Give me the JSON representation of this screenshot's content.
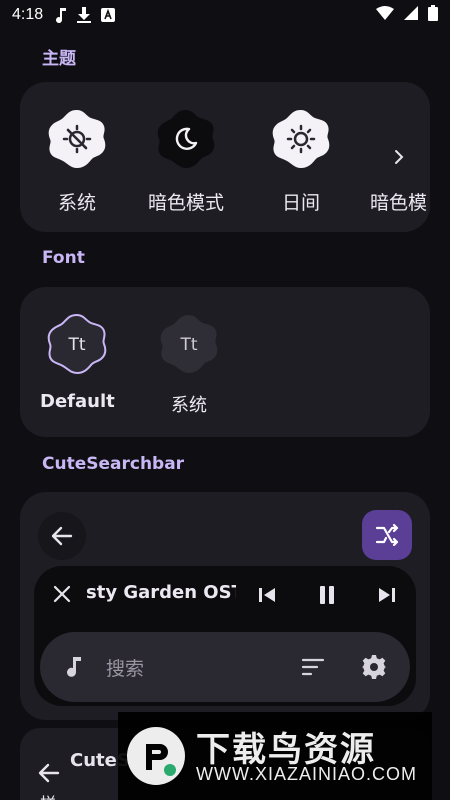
{
  "status_bar": {
    "time": "4:18",
    "icons": [
      "music-note-icon",
      "download-icon",
      "a-badge-icon",
      "wifi-icon",
      "cellular-icon",
      "battery-icon"
    ]
  },
  "sections": {
    "theme_title": "主题",
    "font_title": "Font",
    "searchbar_title": "CuteSearchbar"
  },
  "theme": {
    "items": [
      {
        "label": "系统",
        "icon": "system-theme-icon",
        "selected": false
      },
      {
        "label": "暗色模式",
        "icon": "moon-icon",
        "selected": true
      },
      {
        "label": "日间",
        "icon": "sun-icon",
        "selected": false
      },
      {
        "label": "暗色模",
        "icon": "partial-item",
        "selected": false
      }
    ],
    "next_icon": "chevron-right-icon"
  },
  "font": {
    "items": [
      {
        "label": "Default",
        "glyph": "Tt",
        "selected": true
      },
      {
        "label": "系统",
        "glyph": "Tt",
        "selected": false
      }
    ]
  },
  "searchbar_preview": {
    "back_icon": "arrow-left-icon",
    "shuffle_icon": "shuffle-icon",
    "player": {
      "track_title": "sty Garden OST",
      "close_icon": "close-icon",
      "prev_icon": "skip-previous-icon",
      "pause_icon": "pause-icon",
      "next_icon": "skip-next-icon"
    },
    "search": {
      "placeholder": "搜索",
      "note_icon": "music-note-icon",
      "sort_icon": "sort-icon",
      "settings_icon": "gear-icon"
    }
  },
  "lower_preview": {
    "title": "CuteS",
    "back_icon": "arrow-left-icon",
    "extra": "样"
  },
  "watermark": {
    "title": "下载鸟资源",
    "url": "WWW.XIAZAINIAO.COM"
  },
  "colors": {
    "background": "#0f0e12",
    "card": "#1f1d24",
    "accent": "#c9b6f5",
    "accent_button": "#5b3e96"
  }
}
